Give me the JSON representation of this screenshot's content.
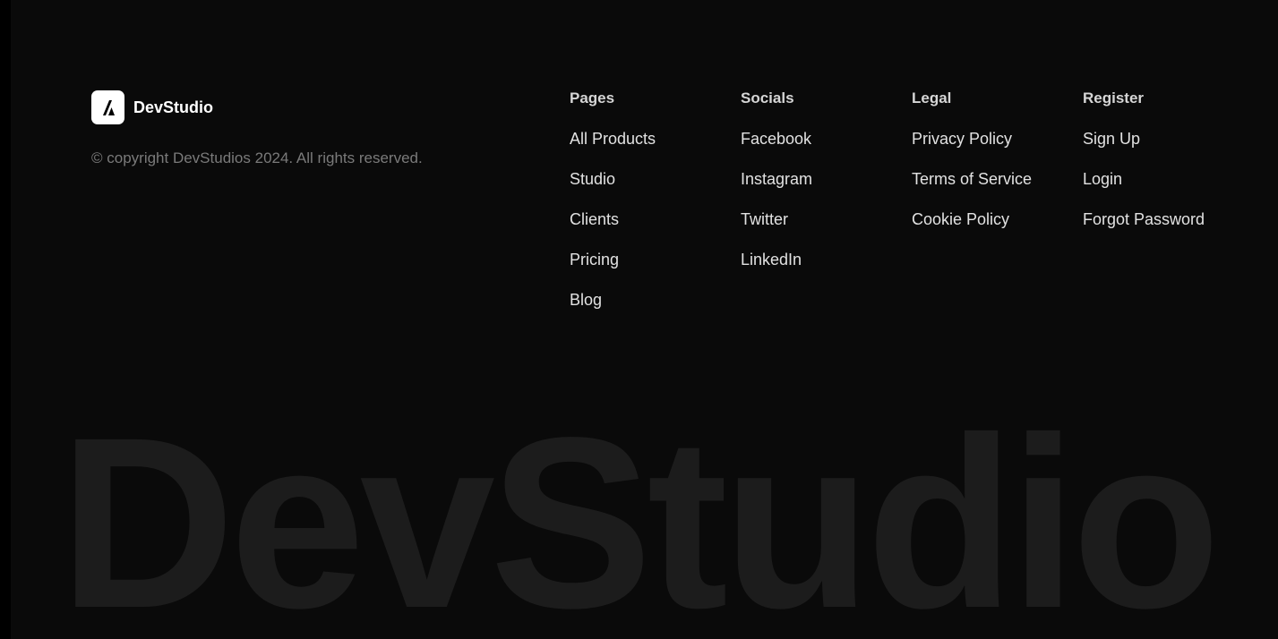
{
  "brand": {
    "name": "DevStudio",
    "logo_icon": "devstudio-logo-icon",
    "copyright": "© copyright DevStudios 2024. All rights reserved."
  },
  "columns": [
    {
      "heading": "Pages",
      "links": [
        "All Products",
        "Studio",
        "Clients",
        "Pricing",
        "Blog"
      ]
    },
    {
      "heading": "Socials",
      "links": [
        "Facebook",
        "Instagram",
        "Twitter",
        "LinkedIn"
      ]
    },
    {
      "heading": "Legal",
      "links": [
        "Privacy Policy",
        "Terms of Service",
        "Cookie Policy"
      ]
    },
    {
      "heading": "Register",
      "links": [
        "Sign Up",
        "Login",
        "Forgot Password"
      ]
    }
  ],
  "watermark": "DevStudio",
  "colors": {
    "background": "#0a0a0a",
    "outer_background": "#000000",
    "link_text": "#e2e2e2",
    "muted_text": "#7a7a7a",
    "watermark_text": "#1c1c1c"
  }
}
